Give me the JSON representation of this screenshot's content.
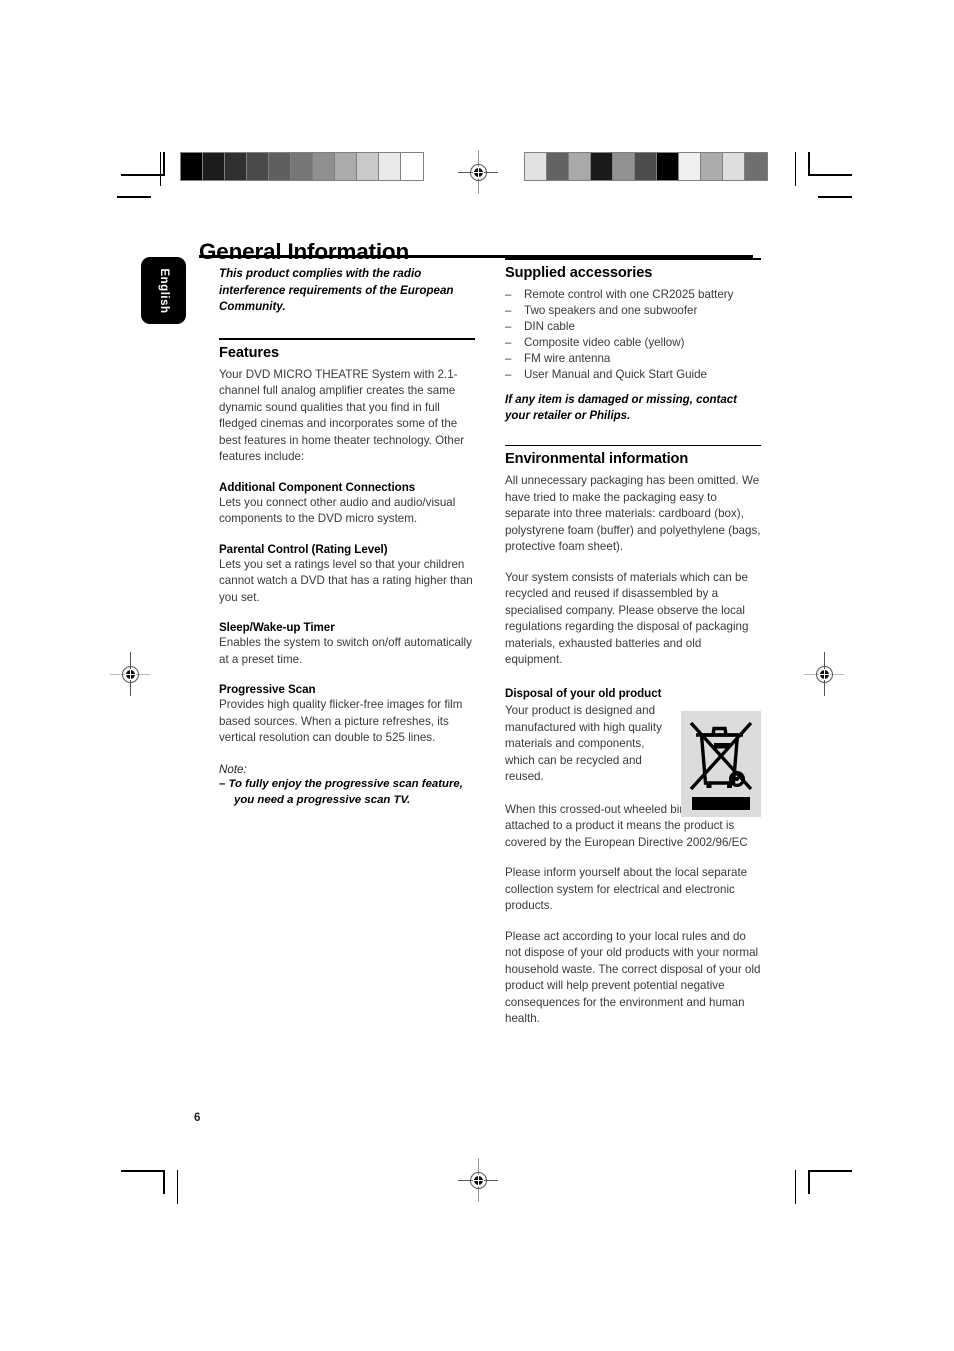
{
  "document": {
    "page_title": "General Information",
    "page_number": "6",
    "language_tab": "English"
  },
  "printer_marks": {
    "colorbar_left": {
      "name": "grayscale-step-wedge",
      "swatches": [
        "#000000",
        "#1c1c1c",
        "#303030",
        "#4a4a4a",
        "#5f5f5f",
        "#767676",
        "#8f8f8f",
        "#ababab",
        "#c9c9c9",
        "#e9e9e9",
        "#ffffff"
      ]
    },
    "colorbar_right": {
      "name": "scrambled-gray-control-strip",
      "swatches": [
        "#e2e2e2",
        "#636363",
        "#a9a9a9",
        "#1a1a1a",
        "#919191",
        "#4c4c4c",
        "#000000",
        "#f0f0f0",
        "#acacac",
        "#dedede",
        "#6f6f6f"
      ]
    }
  },
  "left_column": {
    "intro": "This product complies with the radio interference requirements of the European Community.",
    "features": {
      "heading": "Features",
      "intro": "Your DVD MICRO THEATRE System  with 2.1-channel full analog amplifier creates the same dynamic sound qualities that you find in full fledged cinemas and incorporates some of the best features in home theater technology. Other features include:",
      "items": [
        {
          "heading": "Additional Component Connections",
          "body": "Lets you connect other audio and audio/visual components to the DVD micro system."
        },
        {
          "heading": "Parental Control (Rating Level)",
          "body": "Lets you set a ratings level so that your children cannot watch a DVD that has a rating higher than you set."
        },
        {
          "heading": "Sleep/Wake-up Timer",
          "body": "Enables the system to switch on/off automatically at a preset time."
        },
        {
          "heading": "Progressive Scan",
          "body": "Provides high quality flicker-free images for film based sources. When a picture refreshes, its vertical resolution can double to 525 lines."
        }
      ],
      "note_label": "Note:",
      "note_item": "–  To fully enjoy the progressive scan feature, you need a progressive scan TV."
    }
  },
  "right_column": {
    "supplied_accessories": {
      "heading": "Supplied accessories",
      "items": [
        "Remote control with one CR2025 battery",
        "Two speakers and one subwoofer",
        "DIN cable",
        "Composite video cable (yellow)",
        "FM wire antenna",
        "User Manual and Quick Start Guide"
      ],
      "notice": "If any item is damaged or missing, contact your retailer or Philips."
    },
    "environmental_information": {
      "heading": "Environmental information",
      "paragraphs": [
        "All unnecessary packaging has been omitted. We have tried to make the packaging easy to separate into three materials: cardboard (box), polystyrene foam (buffer) and polyethylene (bags, protective foam sheet).",
        "Your system consists of materials which can be recycled and reused if disassembled by a specialised company. Please observe the local regulations regarding the disposal of packaging materials, exhausted batteries and old equipment."
      ]
    },
    "disposal": {
      "heading": "Disposal of  your old product",
      "intro": "Your product is designed and manufactured with high quality materials and components, which can be recycled and reused.",
      "icon_label": "crossed-out-wheeled-bin-icon",
      "paragraphs": [
        "When this crossed-out wheeled bin symbol is attached to a product it means the product is covered by the European Directive 2002/96/EC",
        "Please inform yourself about the local separate collection system for electrical and electronic products.",
        "Please act according to your local rules and do not dispose of your old products with your normal household waste. The correct disposal of your old product will help prevent potential negative consequences for the environment and human health."
      ]
    }
  }
}
